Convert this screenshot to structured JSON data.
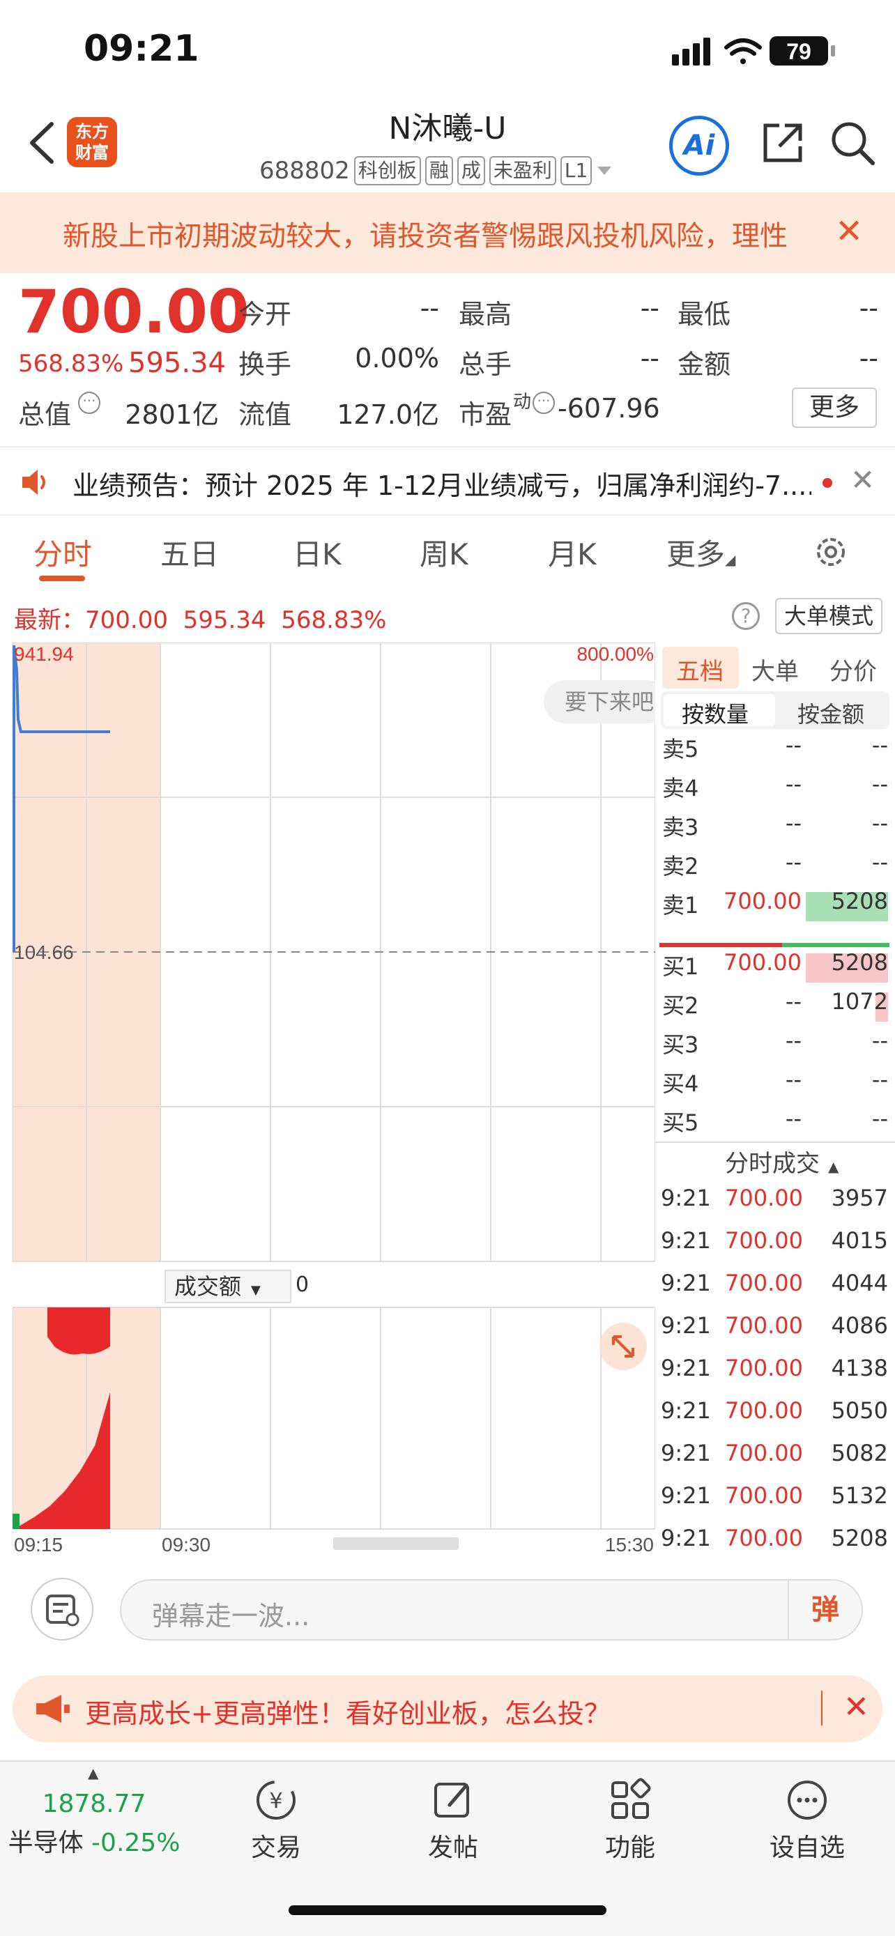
{
  "status_bar": {
    "time": "09:21",
    "battery": "79"
  },
  "header": {
    "logo_line1": "东方",
    "logo_line2": "财富",
    "title": "N沐曦-U",
    "code": "688802",
    "tags": [
      "科创板",
      "融",
      "成",
      "未盈利",
      "L1"
    ],
    "ai_label": "Ai"
  },
  "risk_banner": {
    "text": "新股上市初期波动较大，请投资者警惕跟风投机风险，理性"
  },
  "quote": {
    "price": "700.00",
    "pct": "568.83%",
    "change": "595.34",
    "fields": [
      {
        "label": "今开",
        "value": "--"
      },
      {
        "label": "最高",
        "value": "--"
      },
      {
        "label": "最低",
        "value": "--"
      },
      {
        "label": "换手",
        "value": "0.00%"
      },
      {
        "label": "总手",
        "value": "--"
      },
      {
        "label": "金额",
        "value": "--"
      },
      {
        "label": "总值",
        "value": "2801亿"
      },
      {
        "label": "流值",
        "value": "127.0亿"
      },
      {
        "label": "市盈",
        "value": "-607.96"
      }
    ],
    "pe_superscript": "动",
    "more_label": "更多"
  },
  "notice": {
    "text": "业绩预告：预计 2025 年 1-12月业绩减亏，归属净利润约-7...."
  },
  "tabs": [
    "分时",
    "五日",
    "日K",
    "周K",
    "月K",
    "更多"
  ],
  "latest": {
    "label": "最新：",
    "price": "700.00",
    "change": "595.34",
    "pct": "568.83%"
  },
  "big_order_mode": "大单模式",
  "chart": {
    "y_top": "941.94",
    "y_mid": "104.66",
    "right_top_pct": "800.00%",
    "bubble_text": "要下来吧",
    "volume_selector": "成交额",
    "volume_value": "0",
    "x_labels": [
      "09:15",
      "09:30",
      "15:30"
    ]
  },
  "chart_data": {
    "type": "line",
    "x": [
      "09:15",
      "09:16",
      "09:17",
      "09:18",
      "09:19",
      "09:20",
      "09:21"
    ],
    "series": [
      {
        "values": [
          941.94,
          810,
          720,
          700,
          700,
          700,
          700
        ]
      }
    ],
    "ylim": [
      104.66,
      941.94
    ],
    "volume_series": [
      0.02,
      0.08,
      0.15,
      0.25,
      0.38,
      0.55,
      0.9
    ]
  },
  "levels": {
    "tabs": [
      "五档",
      "大单",
      "分价"
    ],
    "qty_toggle": [
      "按数量",
      "按金额"
    ],
    "asks": [
      {
        "label": "卖5",
        "price": "--",
        "qty": "--"
      },
      {
        "label": "卖4",
        "price": "--",
        "qty": "--"
      },
      {
        "label": "卖3",
        "price": "--",
        "qty": "--"
      },
      {
        "label": "卖2",
        "price": "--",
        "qty": "--"
      },
      {
        "label": "卖1",
        "price": "700.00",
        "qty": "5208"
      }
    ],
    "bids": [
      {
        "label": "买1",
        "price": "700.00",
        "qty": "5208"
      },
      {
        "label": "买2",
        "price": "--",
        "qty": "1072"
      },
      {
        "label": "买3",
        "price": "--",
        "qty": "--"
      },
      {
        "label": "买4",
        "price": "--",
        "qty": "--"
      },
      {
        "label": "买5",
        "price": "--",
        "qty": "--"
      }
    ]
  },
  "trades": {
    "header": "分时成交",
    "rows": [
      {
        "time": "9:21",
        "price": "700.00",
        "qty": "3957"
      },
      {
        "time": "9:21",
        "price": "700.00",
        "qty": "4015"
      },
      {
        "time": "9:21",
        "price": "700.00",
        "qty": "4044"
      },
      {
        "time": "9:21",
        "price": "700.00",
        "qty": "4086"
      },
      {
        "time": "9:21",
        "price": "700.00",
        "qty": "4138"
      },
      {
        "time": "9:21",
        "price": "700.00",
        "qty": "5050"
      },
      {
        "time": "9:21",
        "price": "700.00",
        "qty": "5082"
      },
      {
        "time": "9:21",
        "price": "700.00",
        "qty": "5132"
      },
      {
        "time": "9:21",
        "price": "700.00",
        "qty": "5208"
      }
    ]
  },
  "danmaku": {
    "placeholder": "弹幕走一波...",
    "send_label": "弹"
  },
  "ad": {
    "text": "更高成长+更高弹性！看好创业板，怎么投？"
  },
  "bottom_nav": {
    "index_value": "1878.77",
    "index_name": "半导体",
    "index_pct": "-0.25%",
    "items": [
      "交易",
      "发帖",
      "功能",
      "设自选"
    ]
  }
}
